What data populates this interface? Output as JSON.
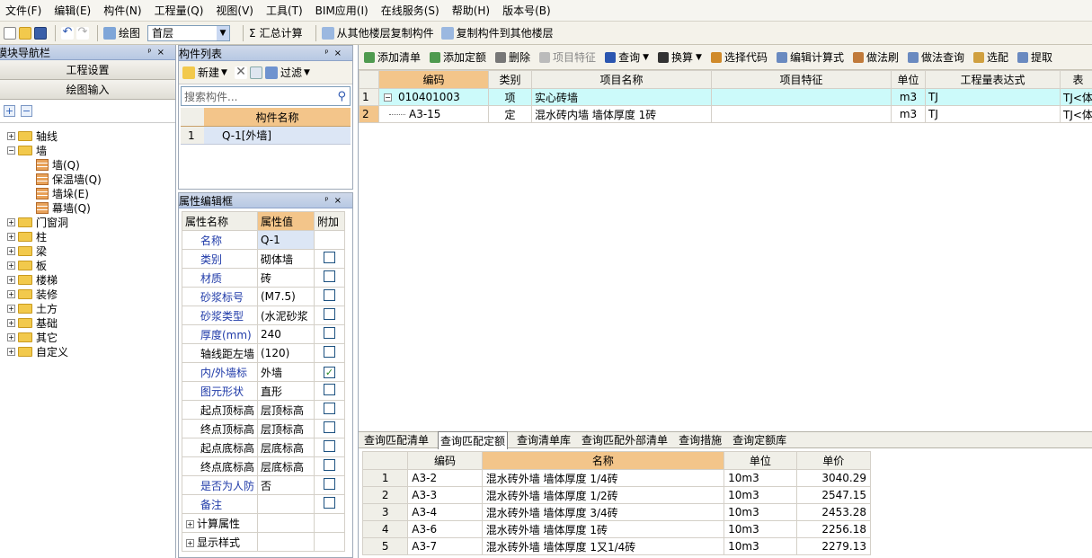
{
  "menu": [
    "文件(F)",
    "编辑(E)",
    "构件(N)",
    "工程量(Q)",
    "视图(V)",
    "工具(T)",
    "BIM应用(I)",
    "在线服务(S)",
    "帮助(H)",
    "版本号(B)"
  ],
  "toolbar": {
    "draw_label": "绘图",
    "floor_value": "首层",
    "sum_label": "汇总计算",
    "copy_from_label": "从其他楼层复制构件",
    "copy_to_label": "复制构件到其他楼层"
  },
  "nav": {
    "title": "模块导航栏",
    "btn_project": "工程设置",
    "btn_draw": "绘图输入",
    "tree": [
      {
        "label": "轴线",
        "level": 0,
        "expand": "+"
      },
      {
        "label": "墙",
        "level": 0,
        "expand": "-",
        "open": true
      },
      {
        "label": "墙(Q)",
        "level": 1
      },
      {
        "label": "保温墙(Q)",
        "level": 1
      },
      {
        "label": "墙垛(E)",
        "level": 1
      },
      {
        "label": "幕墙(Q)",
        "level": 1
      },
      {
        "label": "门窗洞",
        "level": 0,
        "expand": "+"
      },
      {
        "label": "柱",
        "level": 0,
        "expand": "+"
      },
      {
        "label": "梁",
        "level": 0,
        "expand": "+"
      },
      {
        "label": "板",
        "level": 0,
        "expand": "+"
      },
      {
        "label": "楼梯",
        "level": 0,
        "expand": "+"
      },
      {
        "label": "装修",
        "level": 0,
        "expand": "+"
      },
      {
        "label": "土方",
        "level": 0,
        "expand": "+"
      },
      {
        "label": "基础",
        "level": 0,
        "expand": "+"
      },
      {
        "label": "其它",
        "level": 0,
        "expand": "+"
      },
      {
        "label": "自定义",
        "level": 0,
        "expand": "+"
      }
    ]
  },
  "complist": {
    "title": "构件列表",
    "new_label": "新建",
    "filter_label": "过滤",
    "search_placeholder": "搜索构件...",
    "col_name": "构件名称",
    "rows": [
      {
        "no": "1",
        "name": "Q-1[外墙]"
      }
    ]
  },
  "props": {
    "title": "属性编辑框",
    "col_name": "属性名称",
    "col_value": "属性值",
    "col_add": "附加",
    "rows": [
      {
        "name": "名称",
        "value": "Q-1",
        "check": null,
        "blue": true
      },
      {
        "name": "类别",
        "value": "砌体墙",
        "check": false,
        "blue": true
      },
      {
        "name": "材质",
        "value": "砖",
        "check": false,
        "blue": true
      },
      {
        "name": "砂浆标号",
        "value": "(M7.5)",
        "check": false,
        "blue": true
      },
      {
        "name": "砂浆类型",
        "value": "(水泥砂浆",
        "check": false,
        "blue": true
      },
      {
        "name": "厚度(mm)",
        "value": "240",
        "check": false,
        "blue": true
      },
      {
        "name": "轴线距左墙",
        "value": "(120)",
        "check": false,
        "blue": false
      },
      {
        "name": "内/外墙标",
        "value": "外墙",
        "check": true,
        "blue": true
      },
      {
        "name": "图元形状",
        "value": "直形",
        "check": false,
        "blue": true
      },
      {
        "name": "起点顶标高",
        "value": "层顶标高",
        "check": false,
        "blue": false
      },
      {
        "name": "终点顶标高",
        "value": "层顶标高",
        "check": false,
        "blue": false
      },
      {
        "name": "起点底标高",
        "value": "层底标高",
        "check": false,
        "blue": false
      },
      {
        "name": "终点底标高",
        "value": "层底标高",
        "check": false,
        "blue": false
      },
      {
        "name": "是否为人防",
        "value": "否",
        "check": false,
        "blue": true
      },
      {
        "name": "备注",
        "value": "",
        "check": false,
        "blue": true
      }
    ],
    "group1": "计算属性",
    "group2": "显示样式"
  },
  "righttools": [
    "添加清单",
    "添加定额",
    "删除",
    "项目特征",
    "查询",
    "换算",
    "选择代码",
    "编辑计算式",
    "做法刷",
    "做法查询",
    "选配",
    "提取"
  ],
  "main_grid": {
    "headers": [
      "编码",
      "类别",
      "项目名称",
      "项目特征",
      "单位",
      "工程量表达式",
      "表"
    ],
    "rows": [
      {
        "no": "1",
        "code": "010401003",
        "type": "项",
        "name": "实心砖墙",
        "feature": "",
        "unit": "m3",
        "expr": "TJ",
        "extra": "TJ<体积>"
      },
      {
        "no": "2",
        "code": "A3-15",
        "type": "定",
        "name": "混水砖内墙 墙体厚度 1砖",
        "feature": "",
        "unit": "m3",
        "expr": "TJ",
        "extra": "TJ<体积>"
      }
    ]
  },
  "tabs": [
    "查询匹配清单",
    "查询匹配定额",
    "查询清单库",
    "查询匹配外部清单",
    "查询措施",
    "查询定额库"
  ],
  "active_tab": 1,
  "lower_grid": {
    "headers": [
      "编码",
      "名称",
      "单位",
      "单价"
    ],
    "rows": [
      {
        "no": "1",
        "code": "A3-2",
        "name": "混水砖外墙 墙体厚度 1/4砖",
        "unit": "10m3",
        "price": "3040.29"
      },
      {
        "no": "2",
        "code": "A3-3",
        "name": "混水砖外墙 墙体厚度 1/2砖",
        "unit": "10m3",
        "price": "2547.15"
      },
      {
        "no": "3",
        "code": "A3-4",
        "name": "混水砖外墙 墙体厚度 3/4砖",
        "unit": "10m3",
        "price": "2453.28"
      },
      {
        "no": "4",
        "code": "A3-6",
        "name": "混水砖外墙 墙体厚度 1砖",
        "unit": "10m3",
        "price": "2256.18"
      },
      {
        "no": "5",
        "code": "A3-7",
        "name": "混水砖外墙 墙体厚度 1又1/4砖",
        "unit": "10m3",
        "price": "2279.13"
      }
    ]
  }
}
